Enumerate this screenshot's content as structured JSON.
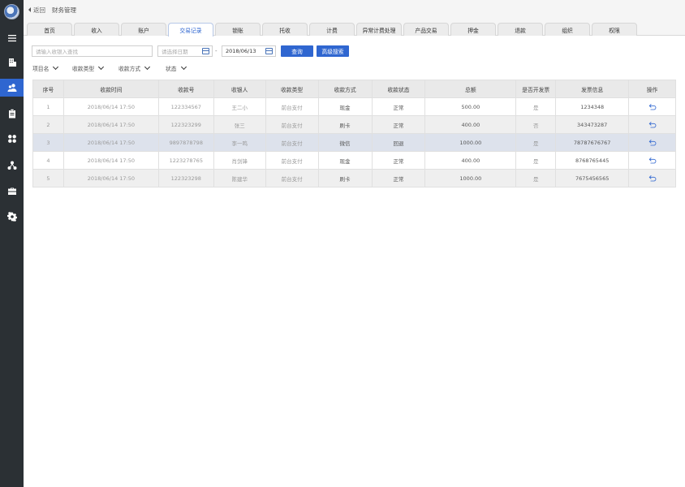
{
  "sidebar": {
    "logo": "logo-avatar",
    "items": [
      {
        "icon": "menu-icon",
        "active": false
      },
      {
        "icon": "building-icon",
        "active": false
      },
      {
        "icon": "users-icon",
        "active": true
      },
      {
        "icon": "clipboard-icon",
        "active": false
      },
      {
        "icon": "apps-icon",
        "active": false
      },
      {
        "icon": "network-icon",
        "active": false
      },
      {
        "icon": "briefcase-icon",
        "active": false
      },
      {
        "icon": "gear-icon",
        "active": false
      }
    ]
  },
  "topbar": {
    "back_label": "返回",
    "crumb": "财务管理"
  },
  "tabs": [
    "首页",
    "收入",
    "账户",
    "交易记录",
    "锁账",
    "托收",
    "计费",
    "异常计费处理",
    "产品交易",
    "押金",
    "退款",
    "组织",
    "权限"
  ],
  "active_tab": "交易记录",
  "filters": {
    "search_placeholder": "请输入收银入查找",
    "date_start_placeholder": "请选择日期",
    "date_separator": "-",
    "date_end_value": "2018/06/13",
    "query_label": "查询",
    "advanced_label": "高级搜索",
    "dropdowns": [
      "项目名",
      "收款类型",
      "收款方式",
      "状态"
    ]
  },
  "table": {
    "headers": [
      "序号",
      "收款时间",
      "收款号",
      "收银人",
      "收款类型",
      "收款方式",
      "收款状态",
      "总额",
      "是否开发票",
      "发票信息",
      "操作"
    ],
    "rows": [
      [
        "1",
        "2018/06/14   17:50",
        "122334567",
        "王二小",
        "前台支付",
        "现金",
        "正常",
        "500.00",
        "是",
        "1234348"
      ],
      [
        "2",
        "2018/06/14   17:50",
        "122323299",
        "张三",
        "前台支付",
        "刷卡",
        "正常",
        "400.00",
        "否",
        "343473287"
      ],
      [
        "3",
        "2018/06/14   17:50",
        "9897878798",
        "李一鸣",
        "前台支付",
        "微信",
        "回退",
        "1000.00",
        "是",
        "78787676767"
      ],
      [
        "4",
        "2018/06/14   17:50",
        "1223278765",
        "肖剑锋",
        "前台支付",
        "现金",
        "正常",
        "400.00",
        "是",
        "8768765445"
      ],
      [
        "5",
        "2018/06/14   17:50",
        "122323298",
        "陈建华",
        "前台支付",
        "刷卡",
        "正常",
        "1000.00",
        "是",
        "7675456565"
      ]
    ],
    "action_icon": "undo-icon",
    "selected_row": 3
  }
}
